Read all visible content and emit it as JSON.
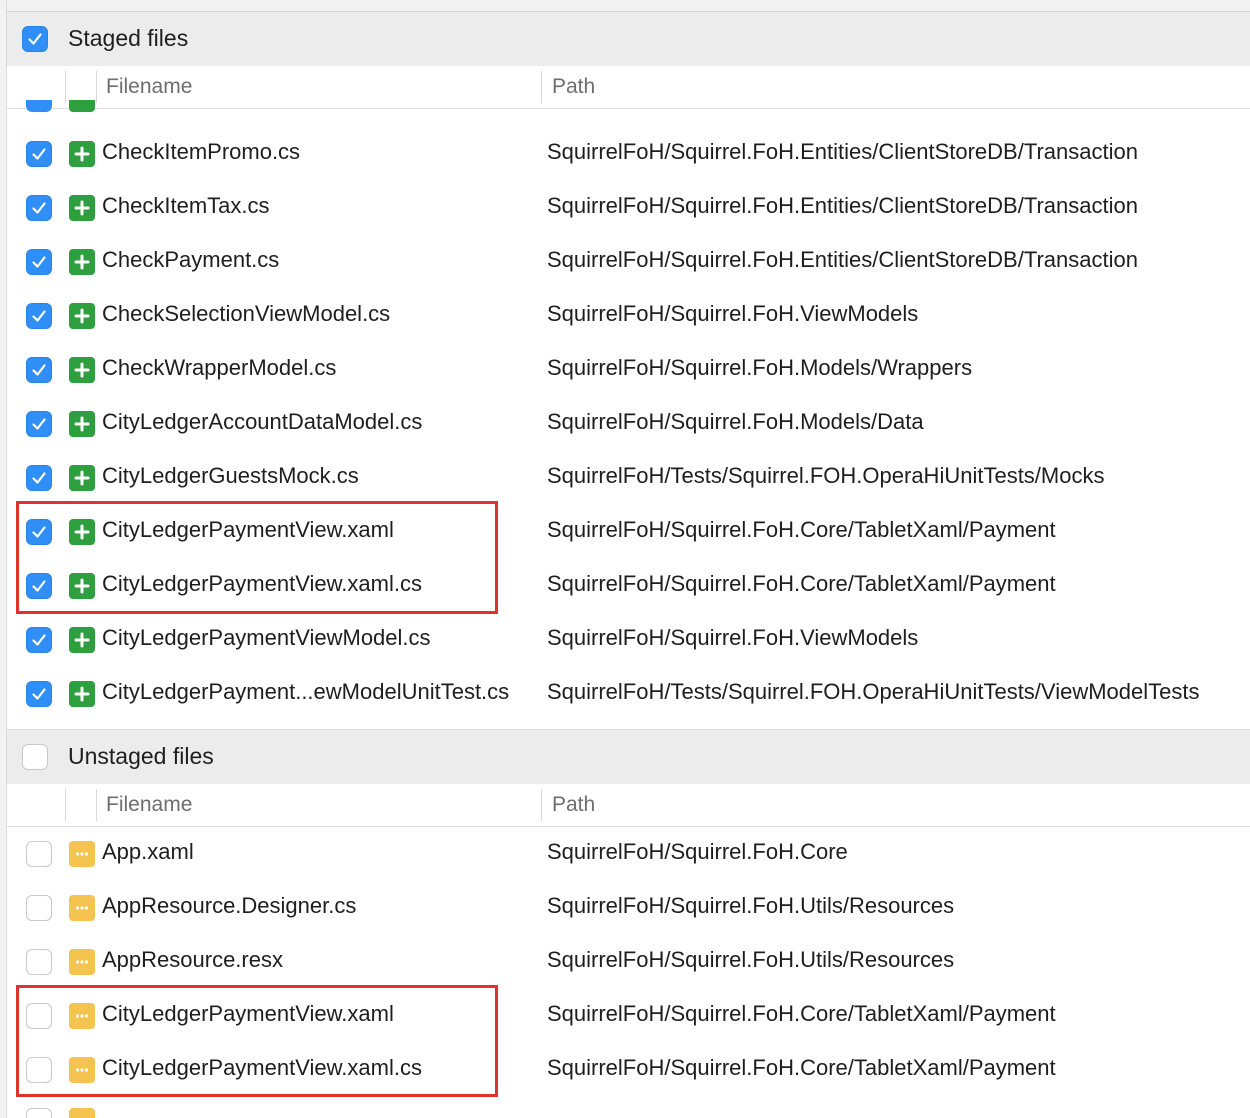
{
  "staged": {
    "title": "Staged files",
    "checked": true,
    "columns": {
      "filename": "Filename",
      "path": "Path"
    },
    "files": [
      {
        "name": "CheckItemPromo.cs",
        "path": "SquirrelFoH/Squirrel.FoH.Entities/ClientStoreDB/Transaction",
        "status": "added",
        "checked": true
      },
      {
        "name": "CheckItemTax.cs",
        "path": "SquirrelFoH/Squirrel.FoH.Entities/ClientStoreDB/Transaction",
        "status": "added",
        "checked": true
      },
      {
        "name": "CheckPayment.cs",
        "path": "SquirrelFoH/Squirrel.FoH.Entities/ClientStoreDB/Transaction",
        "status": "added",
        "checked": true
      },
      {
        "name": "CheckSelectionViewModel.cs",
        "path": "SquirrelFoH/Squirrel.FoH.ViewModels",
        "status": "added",
        "checked": true
      },
      {
        "name": "CheckWrapperModel.cs",
        "path": "SquirrelFoH/Squirrel.FoH.Models/Wrappers",
        "status": "added",
        "checked": true
      },
      {
        "name": "CityLedgerAccountDataModel.cs",
        "path": "SquirrelFoH/Squirrel.FoH.Models/Data",
        "status": "added",
        "checked": true
      },
      {
        "name": "CityLedgerGuestsMock.cs",
        "path": "SquirrelFoH/Tests/Squirrel.FOH.OperaHiUnitTests/Mocks",
        "status": "added",
        "checked": true
      },
      {
        "name": "CityLedgerPaymentView.xaml",
        "path": "SquirrelFoH/Squirrel.FoH.Core/TabletXaml/Payment",
        "status": "added",
        "checked": true
      },
      {
        "name": "CityLedgerPaymentView.xaml.cs",
        "path": "SquirrelFoH/Squirrel.FoH.Core/TabletXaml/Payment",
        "status": "added",
        "checked": true
      },
      {
        "name": "CityLedgerPaymentViewModel.cs",
        "path": "SquirrelFoH/Squirrel.FoH.ViewModels",
        "status": "added",
        "checked": true
      },
      {
        "name": "CityLedgerPayment...ewModelUnitTest.cs",
        "path": "SquirrelFoH/Tests/Squirrel.FOH.OperaHiUnitTests/ViewModelTests",
        "status": "added",
        "checked": true
      }
    ]
  },
  "unstaged": {
    "title": "Unstaged files",
    "checked": false,
    "columns": {
      "filename": "Filename",
      "path": "Path"
    },
    "files": [
      {
        "name": "App.xaml",
        "path": "SquirrelFoH/Squirrel.FoH.Core",
        "status": "modified",
        "checked": false
      },
      {
        "name": "AppResource.Designer.cs",
        "path": "SquirrelFoH/Squirrel.FoH.Utils/Resources",
        "status": "modified",
        "checked": false
      },
      {
        "name": "AppResource.resx",
        "path": "SquirrelFoH/Squirrel.FoH.Utils/Resources",
        "status": "modified",
        "checked": false
      },
      {
        "name": "CityLedgerPaymentView.xaml",
        "path": "SquirrelFoH/Squirrel.FoH.Core/TabletXaml/Payment",
        "status": "modified",
        "checked": false
      },
      {
        "name": "CityLedgerPaymentView.xaml.cs",
        "path": "SquirrelFoH/Squirrel.FoH.Core/TabletXaml/Payment",
        "status": "modified",
        "checked": false
      }
    ]
  },
  "colors": {
    "checkbox_on": "#2f8ff6",
    "added_badge": "#2e9f3e",
    "modified_badge": "#f5c350",
    "highlight": "#e0332c",
    "header_bg": "#ececec"
  },
  "icons": {
    "added": "plus-icon",
    "modified": "ellipsis-icon",
    "checked": "checkmark-icon"
  }
}
